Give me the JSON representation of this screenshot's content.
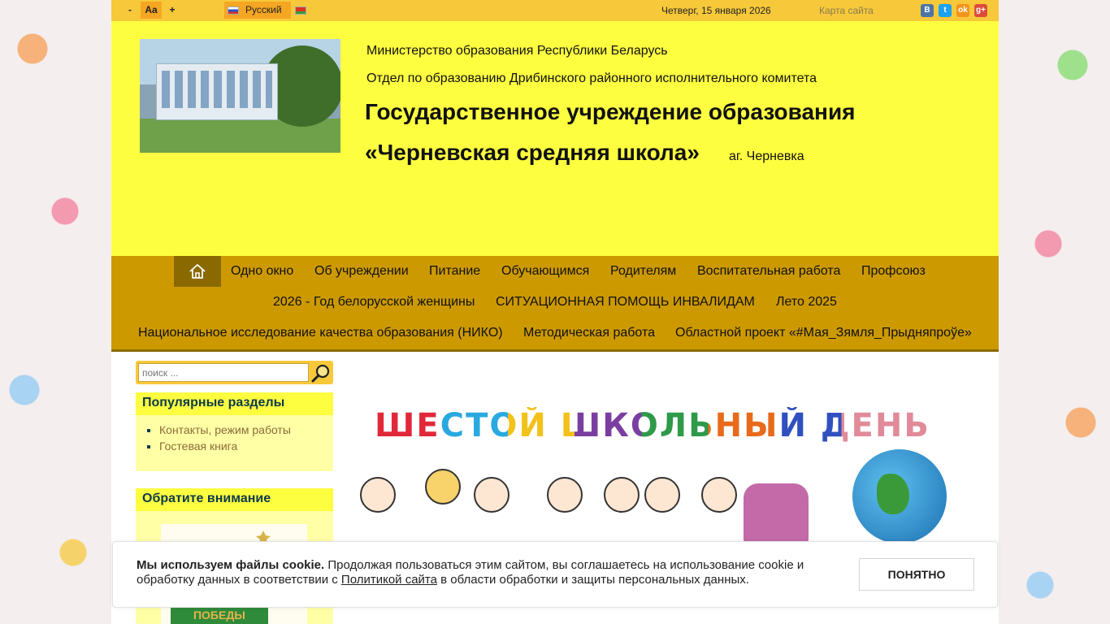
{
  "topbar": {
    "font_minus": "-",
    "font_normal": "Aa",
    "font_plus": "+",
    "language": "Русский",
    "date": "Четверг, 15 января 2026",
    "sitemap": "Карта сайта",
    "social": {
      "vk": "В",
      "tw": "t",
      "ok": "ok",
      "gp": "g+"
    }
  },
  "header": {
    "ministry": "Министерство образования Республики Беларусь",
    "department": "Отдел по образованию Дрибинского районного исполнительного комитета",
    "title_line1": "Государственное учреждение образования",
    "title_line2": "«Черневская средняя школа»",
    "village": "аг. Черневка"
  },
  "nav": {
    "items": [
      "Одно окно",
      "Об учреждении",
      "Питание",
      "Обучающимся",
      "Родителям",
      "Воспитательная работа",
      "Профсоюз",
      "2026 - Год белорусской женщины",
      "СИТУАЦИОННАЯ ПОМОЩЬ ИНВАЛИДАМ",
      "Лето 2025",
      "Национальное исследование качества образования (НИКО)",
      "Методическая работа",
      "Областной проект «#Мая_Зямля_Прыдняпроўе»"
    ]
  },
  "search": {
    "placeholder": "поиск ..."
  },
  "sidebar": {
    "popular_title": "Популярные разделы",
    "popular_items": [
      "Контакты, режим работы",
      "Гостевая книга"
    ],
    "notice_title": "Обратите внимание",
    "notice_image_text": "ПОБЕДЫ"
  },
  "banner": {
    "title": "ШЕСТОЙ ШКОЛЬНЫЙ ДЕНЬ"
  },
  "cookie": {
    "bold": "Мы используем файлы cookie.",
    "text1": " Продолжая пользоваться этим сайтом, вы соглашаетесь на использование cookie и обработку данных в соответствии с ",
    "link": "Политикой сайта",
    "text2": " в области обработки и защиты персональных данных.",
    "button": "ПОНЯТНО"
  },
  "colors": {
    "header_bg": "#fefe41",
    "topbar_bg": "#f7c93a",
    "nav_bg": "#cc9900",
    "nav_active": "#8a6a00"
  }
}
